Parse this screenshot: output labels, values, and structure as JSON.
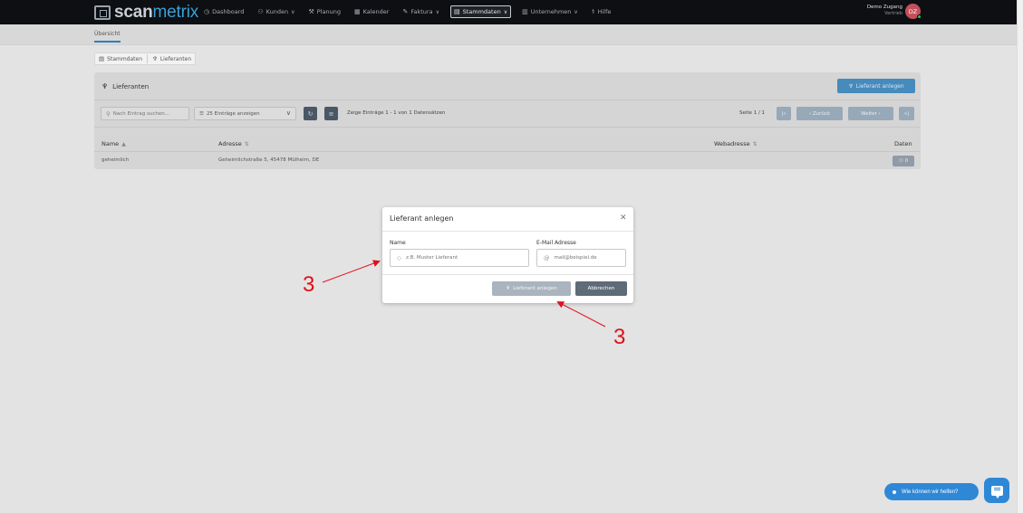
{
  "brand": {
    "scan": "scan",
    "metrix": "metrix"
  },
  "nav": [
    {
      "label": "Dashboard",
      "icon": "dashboard-icon",
      "has_dropdown": false
    },
    {
      "label": "Kunden",
      "icon": "users-icon",
      "has_dropdown": true
    },
    {
      "label": "Planung",
      "icon": "planning-icon",
      "has_dropdown": false
    },
    {
      "label": "Kalender",
      "icon": "calendar-icon",
      "has_dropdown": false
    },
    {
      "label": "Faktura",
      "icon": "invoice-icon",
      "has_dropdown": true
    },
    {
      "label": "Stammdaten",
      "icon": "database-icon",
      "has_dropdown": true,
      "active": true
    },
    {
      "label": "Unternehmen",
      "icon": "building-icon",
      "has_dropdown": true
    },
    {
      "label": "Hilfe",
      "icon": "help-icon",
      "has_dropdown": false
    }
  ],
  "user": {
    "name": "Demo Zugang",
    "role": "Vertrieb",
    "initials": "DZ",
    "status_color": "#2ec15a"
  },
  "tabs": {
    "overview": "Übersicht"
  },
  "breadcrumb": {
    "item1": "Stammdaten",
    "item2": "Lieferanten"
  },
  "card": {
    "title": "Lieferanten",
    "add_button": "Lieferant anlegen",
    "search_placeholder": "Nach Eintrag suchen...",
    "page_size": "25 Einträge anzeigen",
    "entries_info": "Zeige Einträge 1 - 1 von 1 Datensätzen",
    "page_info": "Seite 1 / 1",
    "pagination": {
      "first": "|«",
      "prev": "‹ Zurück",
      "next": "Weiter ›",
      "last": "»|"
    },
    "columns": {
      "name": "Name",
      "address": "Adresse",
      "web": "Webadresse",
      "data": "Daten"
    },
    "rows": [
      {
        "name": "geheimlich",
        "address": "Geheimlichstraße 5, 45478 Mülheim, DE",
        "web": "",
        "data_count": "0"
      }
    ]
  },
  "modal": {
    "title": "Lieferant anlegen",
    "name_label": "Name",
    "name_placeholder": "z.B. Muster Lieferant",
    "email_label": "E-Mail Adresse",
    "email_placeholder": "mail@beispiel.de",
    "save_button": "Lieferant anlegen",
    "cancel_button": "Abbrechen"
  },
  "annotations": {
    "left_number": "3",
    "right_number": "3",
    "color": "#e0101a"
  },
  "help_widget": {
    "label": "Wie können wir helfen?",
    "color": "#2f88d6"
  },
  "colors": {
    "primary": "#2e7fb8",
    "topbar": "#0d0f12",
    "accent_logo": "#3aa0d8"
  }
}
